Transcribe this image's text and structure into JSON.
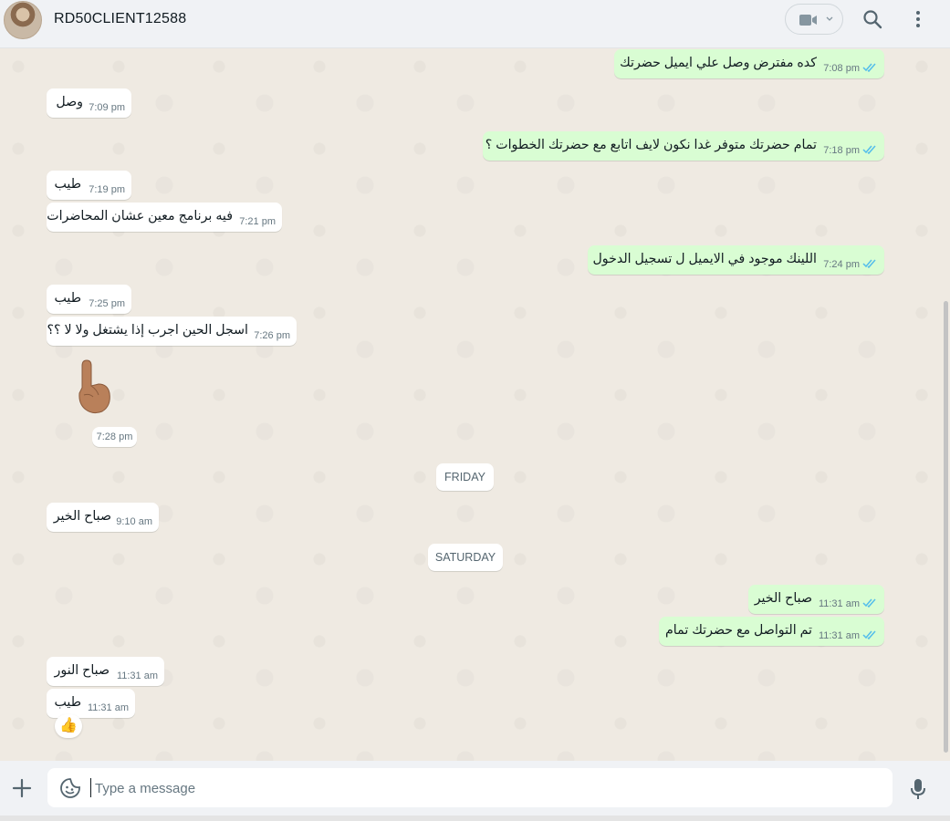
{
  "header": {
    "contact_name": "RD50CLIENT12588",
    "icons": [
      "video-call-icon",
      "chevron-down-icon",
      "search-icon",
      "menu-dots-icon"
    ]
  },
  "messages": [
    {
      "dir": "out",
      "text": "كده مفترض وصل علي ايميل حضرتك",
      "time": "7:08 pm",
      "read": true
    },
    {
      "dir": "in",
      "text": "وصل",
      "time": "7:09 pm"
    },
    {
      "dir": "out",
      "text": "تمام حضرتك متوفر غدا نكون لايف اتابع مع حضرتك الخطوات ؟",
      "time": "7:18 pm",
      "read": true
    },
    {
      "dir": "in",
      "text": "طيب",
      "time": "7:19 pm"
    },
    {
      "dir": "in",
      "text": "فيه برنامج معين عشان المحاضرات",
      "time": "7:21 pm"
    },
    {
      "dir": "out",
      "text": "اللينك موجود في الايميل ل تسجيل الدخول",
      "time": "7:24 pm",
      "read": true
    },
    {
      "dir": "in",
      "text": "طيب",
      "time": "7:25 pm"
    },
    {
      "dir": "in",
      "text": "اسجل الحين اجرب إذا يشتغل ولا لا ؟؟",
      "time": "7:26 pm"
    },
    {
      "dir": "in",
      "text": "صباح الخير",
      "time": "9:10 am"
    },
    {
      "dir": "out",
      "text": "صباح الخير",
      "time": "11:31 am",
      "read": true
    },
    {
      "dir": "out",
      "text": "تم التواصل مع حضرتك تمام",
      "time": "11:31 am",
      "read": true
    },
    {
      "dir": "in",
      "text": "صباح النور",
      "time": "11:31 am"
    },
    {
      "dir": "in",
      "text": "طيب",
      "time": "11:31 am"
    }
  ],
  "sticker": {
    "emoji": "👆🏽",
    "time": "7:28 pm"
  },
  "date_separators": [
    "FRIDAY",
    "SATURDAY"
  ],
  "reaction": {
    "emoji": "👍"
  },
  "composer": {
    "placeholder": "Type a message"
  },
  "colors": {
    "outgoing_bubble": "#d9fdd3",
    "incoming_bubble": "#ffffff",
    "chat_background": "#efeae2",
    "read_ticks": "#53bdeb"
  }
}
